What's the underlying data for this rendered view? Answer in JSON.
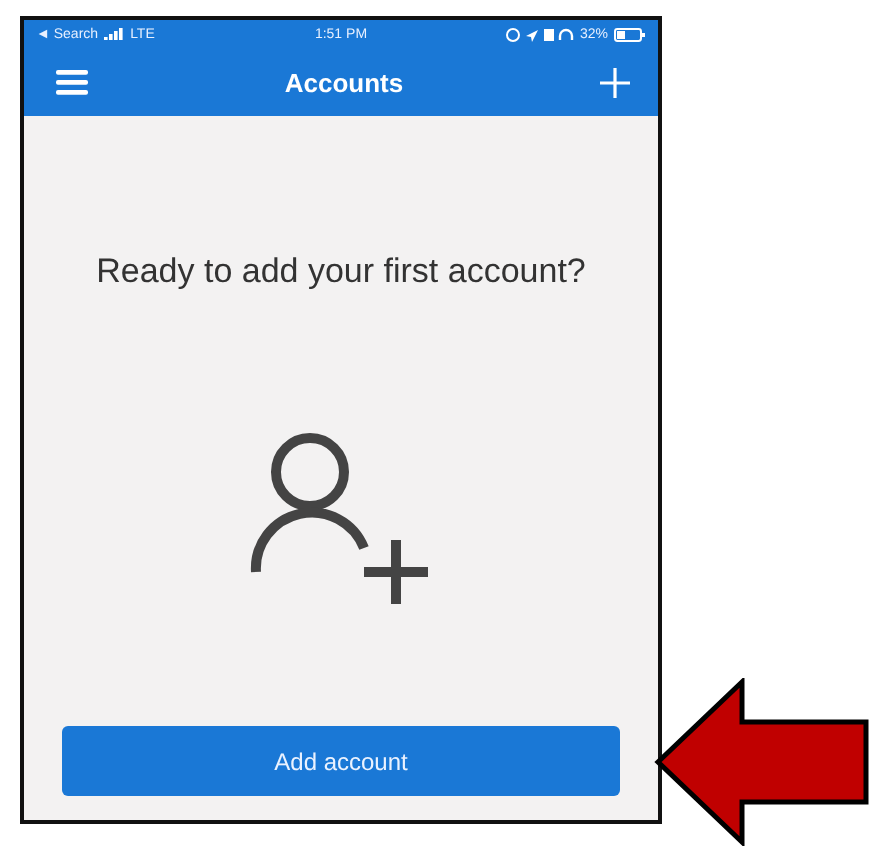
{
  "status_bar": {
    "back": "◄ Search",
    "network": "LTE",
    "time": "1:51 PM",
    "battery": "32%"
  },
  "nav": {
    "title": "Accounts"
  },
  "empty_state": {
    "message": "Ready to add your first account?"
  },
  "button": {
    "label": "Add account"
  }
}
